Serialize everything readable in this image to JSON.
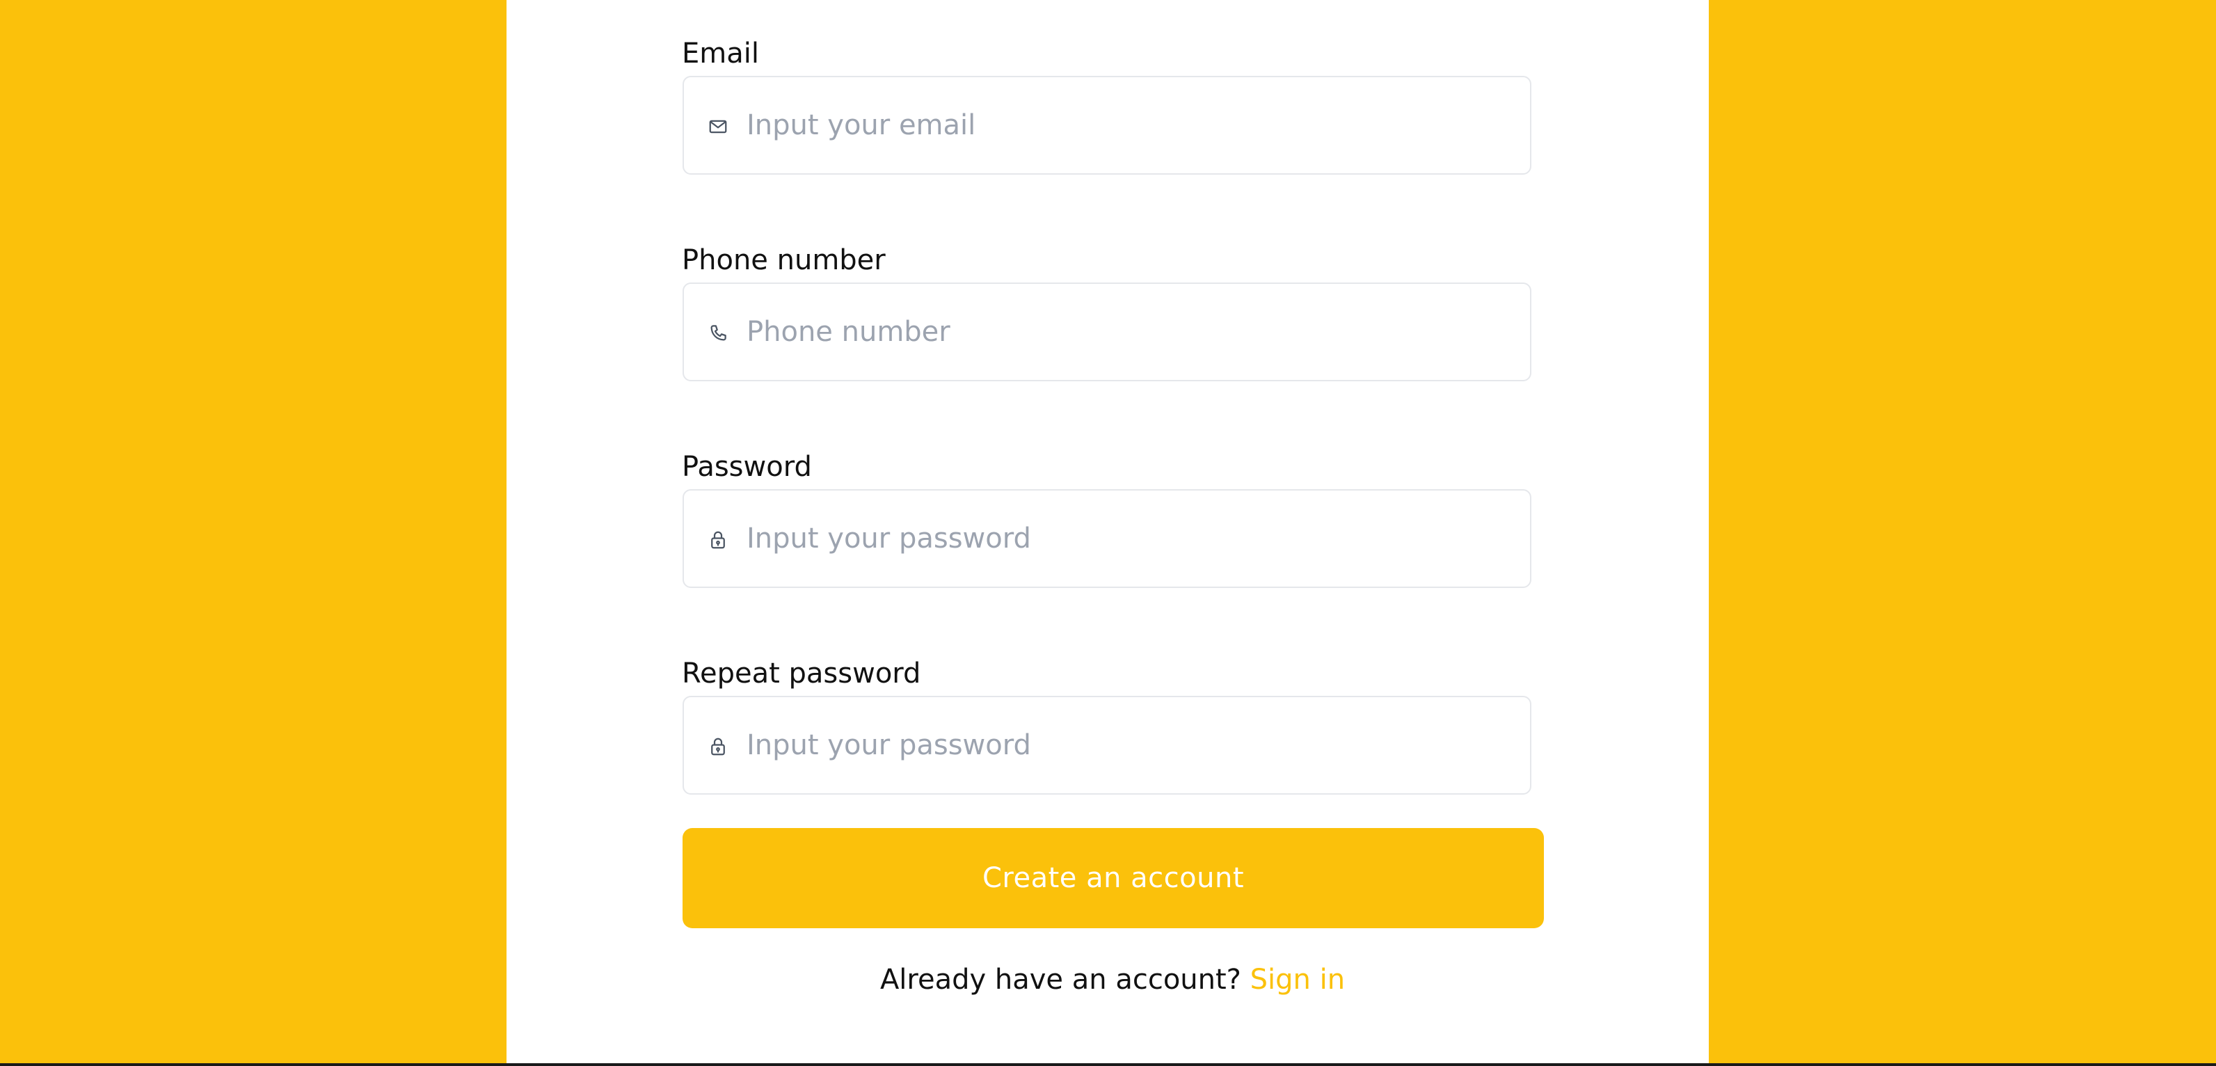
{
  "theme": {
    "accent": "#FBC10B",
    "panel_bg": "#FFFFFF",
    "placeholder_color": "#9CA3AF"
  },
  "form": {
    "email": {
      "label": "Email",
      "placeholder": "Input your email",
      "icon": "mail-icon"
    },
    "phone": {
      "label": "Phone number",
      "placeholder": "Phone number",
      "icon": "phone-icon"
    },
    "password": {
      "label": "Password",
      "placeholder": "Input your password",
      "icon": "lock-icon"
    },
    "repeat_password": {
      "label": "Repeat password",
      "placeholder": "Input your password",
      "icon": "lock-icon"
    },
    "submit_label": "Create an account",
    "signin_prompt": "Already have an account?",
    "signin_link": "Sign in"
  }
}
